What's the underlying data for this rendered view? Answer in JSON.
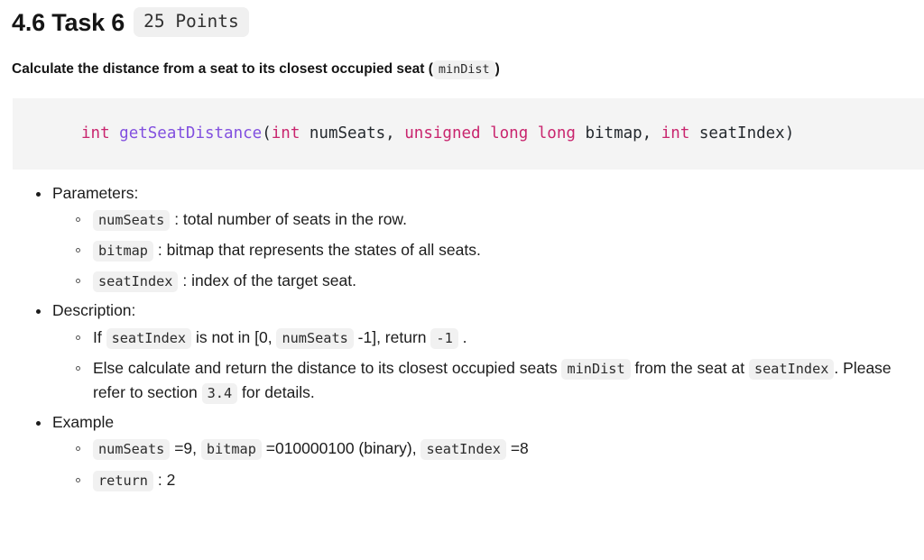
{
  "heading": {
    "number_title": "4.6 Task 6",
    "points_badge": "25 Points"
  },
  "subtitle": {
    "before": "Calculate the distance from a seat to its closest occupied seat (",
    "code": "minDist",
    "after": ")"
  },
  "code_block": {
    "language": "c",
    "tokens": [
      {
        "text": "int",
        "type": "keyword"
      },
      {
        "text": " ",
        "type": "plain"
      },
      {
        "text": "getSeatDistance",
        "type": "function"
      },
      {
        "text": "(",
        "type": "plain"
      },
      {
        "text": "int",
        "type": "keyword"
      },
      {
        "text": " numSeats, ",
        "type": "plain"
      },
      {
        "text": "unsigned long long",
        "type": "keyword"
      },
      {
        "text": " bitmap, ",
        "type": "plain"
      },
      {
        "text": "int",
        "type": "keyword"
      },
      {
        "text": " seatIndex)",
        "type": "plain"
      }
    ],
    "full_text": "int getSeatDistance(int numSeats, unsigned long long bitmap, int seatIndex)",
    "background": "#f4f4f4",
    "keyword_color": "#c9256e",
    "function_color": "#8250df",
    "plain_color": "#24292e"
  },
  "sections": {
    "parameters": {
      "label": "Parameters:",
      "items": [
        {
          "code": "numSeats",
          "text": ": total number of seats in the row."
        },
        {
          "code": "bitmap",
          "text": ": bitmap that represents the states of all seats."
        },
        {
          "code": "seatIndex",
          "text": ": index of the target seat."
        }
      ]
    },
    "description": {
      "label": "Description:",
      "item1": {
        "p1": "If",
        "c1": "seatIndex",
        "p2": "is not in [0,",
        "c2": "numSeats",
        "p3": "-1], return",
        "c3": "-1",
        "p4": "."
      },
      "item2": {
        "p1": "Else calculate and return the distance to its closest occupied seats",
        "c1": "minDist",
        "p2": "from the seat at",
        "c2": "seatIndex",
        "p3": ". Please refer to section",
        "c3": "3.4",
        "p4": "for details."
      }
    },
    "example": {
      "label": "Example",
      "item1": {
        "c1": "numSeats",
        "p1": "=9,",
        "c2": "bitmap",
        "p2": "=010000100 (binary),",
        "c3": "seatIndex",
        "p3": "=8"
      },
      "item2": {
        "c1": "return",
        "p1": ": 2"
      }
    }
  }
}
